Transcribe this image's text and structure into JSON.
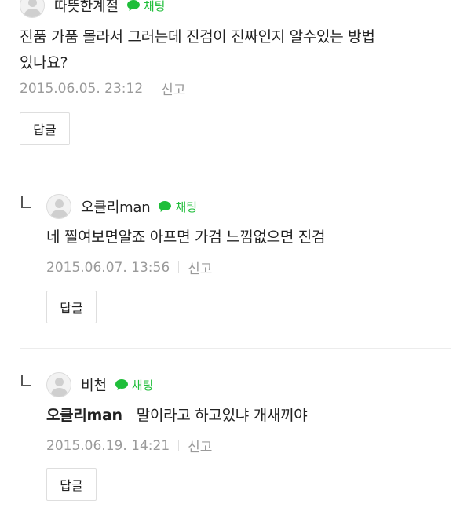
{
  "comments": [
    {
      "nickname": "따뜻한계절",
      "chat_label": "채팅",
      "text_line1": "진품 가품 몰라서 그러는데 진검이 진짜인지 알수있는 방법",
      "text_line2": "있나요?",
      "timestamp": "2015.06.05. 23:12",
      "report_label": "신고",
      "reply_label": "답글"
    },
    {
      "nickname": "오클리man",
      "chat_label": "채팅",
      "text_line1": "네 찔여보면알죠 아프면 가검 느낌없으면 진검",
      "timestamp": "2015.06.07. 13:56",
      "report_label": "신고",
      "reply_label": "답글"
    },
    {
      "nickname": "비천",
      "chat_label": "채팅",
      "mention": "오클리man",
      "text_line1": "말이라고 하고있냐 개새끼야",
      "timestamp": "2015.06.19. 14:21",
      "report_label": "신고",
      "reply_label": "답글"
    }
  ],
  "colors": {
    "chat_green": "#1fbe3a",
    "meta_gray": "#9a9a9a",
    "divider": "#ececec"
  },
  "icons": {
    "avatar": "default-avatar-icon",
    "chat": "chat-bubble-icon",
    "reply_mark": "reply-arrow-icon"
  }
}
